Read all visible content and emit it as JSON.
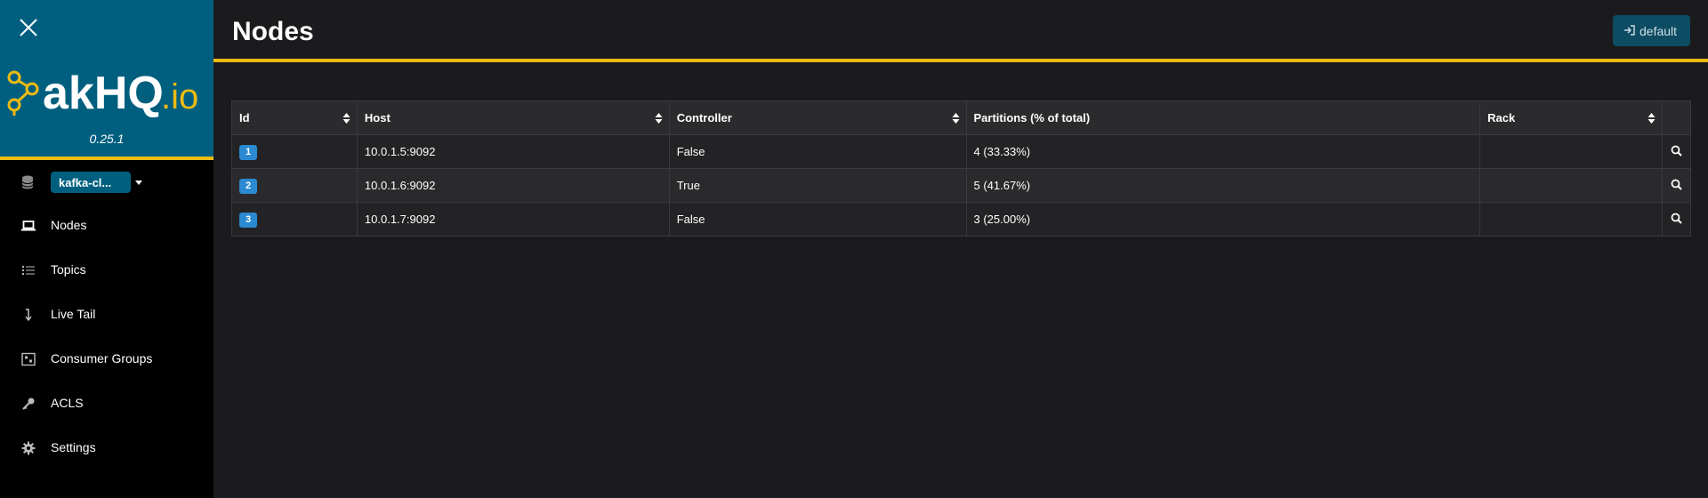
{
  "sidebar": {
    "version": "0.25.1",
    "cluster_label": "kafka-cl...",
    "items": [
      {
        "label": "Nodes",
        "icon": "laptop-icon"
      },
      {
        "label": "Topics",
        "icon": "list-icon"
      },
      {
        "label": "Live Tail",
        "icon": "arrow-down-icon"
      },
      {
        "label": "Consumer Groups",
        "icon": "group-icon"
      },
      {
        "label": "ACLS",
        "icon": "key-icon"
      },
      {
        "label": "Settings",
        "icon": "gear-icon"
      }
    ]
  },
  "header": {
    "title": "Nodes",
    "default_button": "default"
  },
  "table": {
    "columns": [
      "Id",
      "Host",
      "Controller",
      "Partitions (% of total)",
      "Rack"
    ],
    "rows": [
      {
        "id": "1",
        "host": "10.0.1.5:9092",
        "controller": "False",
        "partitions": "4 (33.33%)",
        "rack": ""
      },
      {
        "id": "2",
        "host": "10.0.1.6:9092",
        "controller": "True",
        "partitions": "5 (41.67%)",
        "rack": ""
      },
      {
        "id": "3",
        "host": "10.0.1.7:9092",
        "controller": "False",
        "partitions": "3 (25.00%)",
        "rack": ""
      }
    ]
  },
  "colors": {
    "brand": "#005f7f",
    "accent": "#ecbb13",
    "badge": "#2b8ad1"
  }
}
